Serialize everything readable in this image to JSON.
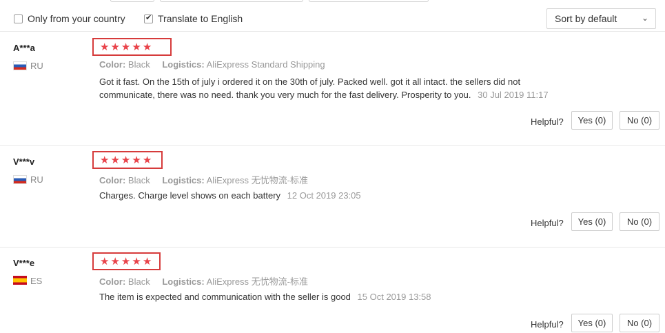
{
  "filters": {
    "only_country_label": "Only from your country",
    "only_country_checked": false,
    "translate_label": "Translate to English",
    "translate_checked": true,
    "sort_value": "Sort by default"
  },
  "labels": {
    "color": "Color:",
    "logistics": "Logistics:",
    "helpful": "Helpful?"
  },
  "reviews": [
    {
      "user": "A***a",
      "country": "RU",
      "flag": "ru",
      "rating": 5,
      "color": "Black",
      "logistics": "AliExpress Standard Shipping",
      "text": "Got it fast. On the 15th of july i ordered it on the 30th of july. Packed well. got it all intact. the sellers did not communicate, there was no need. thank you very much for the fast delivery. Prosperity to you.",
      "date": "30 Jul 2019 11:17",
      "yes": "Yes (0)",
      "no": "No (0)"
    },
    {
      "user": "V***v",
      "country": "RU",
      "flag": "ru",
      "rating": 5,
      "color": "Black",
      "logistics": "AliExpress 无忧物流-标准",
      "text": "Charges. Charge level shows on each battery",
      "date": "12 Oct 2019 23:05",
      "yes": "Yes (0)",
      "no": "No (0)"
    },
    {
      "user": "V***e",
      "country": "ES",
      "flag": "es",
      "rating": 5,
      "color": "Black",
      "logistics": "AliExpress 无忧物流-标准",
      "text": "The item is expected and communication with the seller is good",
      "date": "15 Oct 2019 13:58",
      "yes": "Yes (0)",
      "no": "No (0)"
    }
  ],
  "colors": {
    "star": "#e9434a",
    "highlight_box": "#d63b3b"
  }
}
